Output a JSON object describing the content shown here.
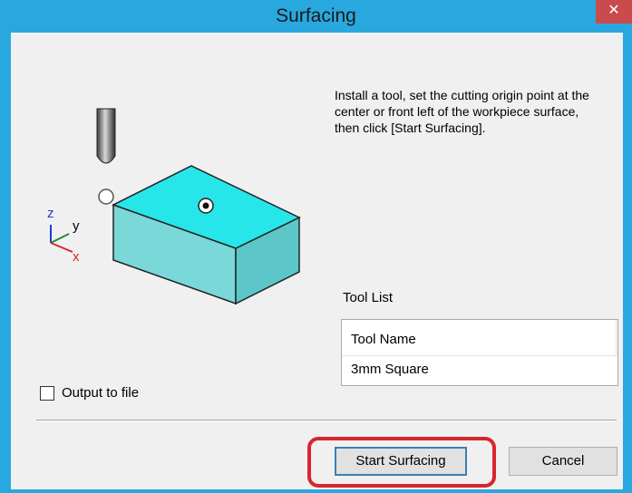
{
  "window": {
    "title": "Surfacing",
    "close_glyph": "✕"
  },
  "instructions": "Install a tool, set the cutting origin point at the center or front left of the workpiece surface, then click [Start Surfacing].",
  "illustration": {
    "axis_labels": {
      "z": "z",
      "y": "y",
      "x": "x"
    },
    "icons": [
      "end-mill-tool",
      "workpiece-box",
      "origin-front-left",
      "origin-center"
    ]
  },
  "tool_list": {
    "label": "Tool List",
    "header": "Tool Name",
    "rows": [
      "3mm Square"
    ]
  },
  "output_checkbox": {
    "label": "Output to file",
    "checked": false
  },
  "buttons": {
    "start": "Start Surfacing",
    "cancel": "Cancel"
  },
  "colors": {
    "titlebar": "#29a8e0",
    "close": "#c94b4b",
    "highlight": "#d9262b",
    "workpiece_top": "#27e6ea",
    "workpiece_front": "#7ad8d8",
    "workpiece_side": "#5cc6c8"
  }
}
